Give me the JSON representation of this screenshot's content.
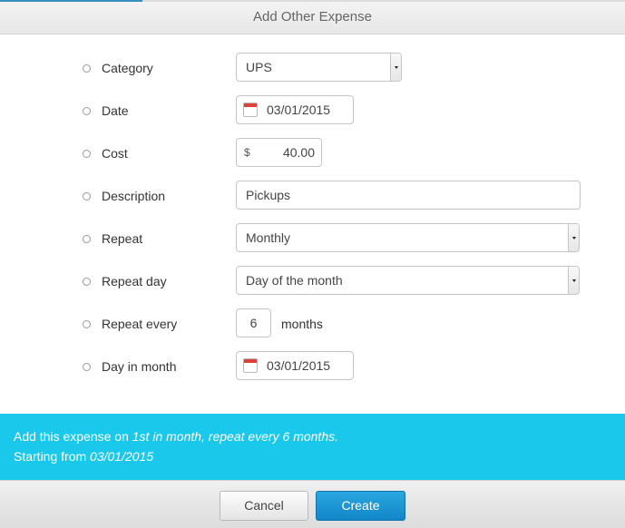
{
  "dialog": {
    "title": "Add Other Expense"
  },
  "form": {
    "category": {
      "label": "Category",
      "value": "UPS"
    },
    "date": {
      "label": "Date",
      "value": "03/01/2015"
    },
    "cost": {
      "label": "Cost",
      "currency": "$",
      "value": "40.00"
    },
    "description": {
      "label": "Description",
      "value": "Pickups"
    },
    "repeat": {
      "label": "Repeat",
      "value": "Monthly"
    },
    "repeat_day": {
      "label": "Repeat day",
      "value": "Day of the month"
    },
    "repeat_every": {
      "label": "Repeat every",
      "value": "6",
      "unit": "months"
    },
    "day_in_month": {
      "label": "Day in month",
      "value": "03/01/2015"
    }
  },
  "summary": {
    "line1_prefix": "Add this expense on ",
    "line1_emphasis": "1st in month, repeat every 6 months.",
    "line2_prefix": "Starting from ",
    "line2_emphasis": "03/01/2015"
  },
  "footer": {
    "cancel_label": "Cancel",
    "create_label": "Create"
  },
  "colors": {
    "summary_bg": "#19c8ea",
    "primary_button": "#1a93d1",
    "calendar_accent": "#d9443a"
  }
}
